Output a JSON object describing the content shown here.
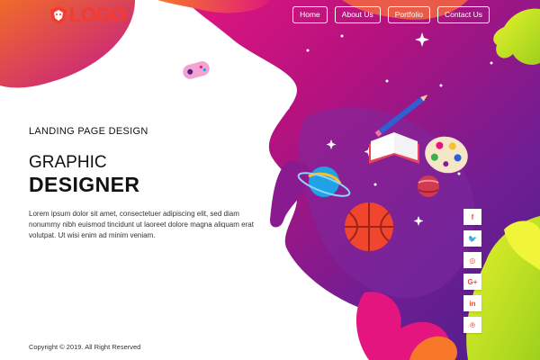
{
  "brand": {
    "logo_text": "LOGO",
    "accent": "#f43b2c"
  },
  "nav": {
    "items": [
      {
        "label": "Home"
      },
      {
        "label": "About Us"
      },
      {
        "label": "Portfolio"
      },
      {
        "label": "Contact Us"
      }
    ]
  },
  "hero": {
    "subtitle": "LANDING PAGE DESIGN",
    "title_line1": "GRAPHIC",
    "title_line2": "DESIGNER",
    "description": "Lorem ipsum dolor sit amet, consectetuer adipiscing elit, sed diam nonummy nibh euismod tincidunt ut laoreet dolore magna aliquam erat volutpat. Ut wisi enim ad minim veniam."
  },
  "footer": {
    "copyright": "Copyright © 2019. All Right Reserved"
  },
  "social": {
    "items": [
      {
        "icon": "facebook-icon",
        "glyph": "f"
      },
      {
        "icon": "twitter-icon",
        "glyph": "🐦"
      },
      {
        "icon": "instagram-icon",
        "glyph": "◎"
      },
      {
        "icon": "google-plus-icon",
        "glyph": "G+"
      },
      {
        "icon": "linkedin-icon",
        "glyph": "in"
      },
      {
        "icon": "pinterest-icon",
        "glyph": "℗"
      }
    ]
  },
  "colors": {
    "purple_dark": "#5b1c8f",
    "magenta": "#c2188c",
    "orange": "#f8782a",
    "lime": "#c6e82a",
    "social_icon": "#f24a34"
  }
}
